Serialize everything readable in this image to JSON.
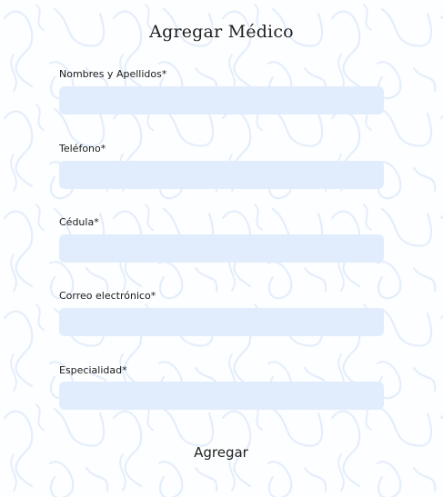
{
  "form": {
    "title": "Agregar Médico",
    "fields": [
      {
        "label": "Nombres y Apellidos*",
        "value": "",
        "placeholder": ""
      },
      {
        "label": "Teléfono*",
        "value": "",
        "placeholder": ""
      },
      {
        "label": "Cédula*",
        "value": "",
        "placeholder": ""
      },
      {
        "label": "Correo electrónico*",
        "value": "",
        "placeholder": ""
      },
      {
        "label": "Especialidad*",
        "value": "",
        "placeholder": ""
      }
    ],
    "submit_label": "Agregar"
  },
  "colors": {
    "background": "#fdfeff",
    "pattern_stroke": "#e4eefb",
    "input_fill": "#e1edfd",
    "text": "#1a1a1a"
  }
}
